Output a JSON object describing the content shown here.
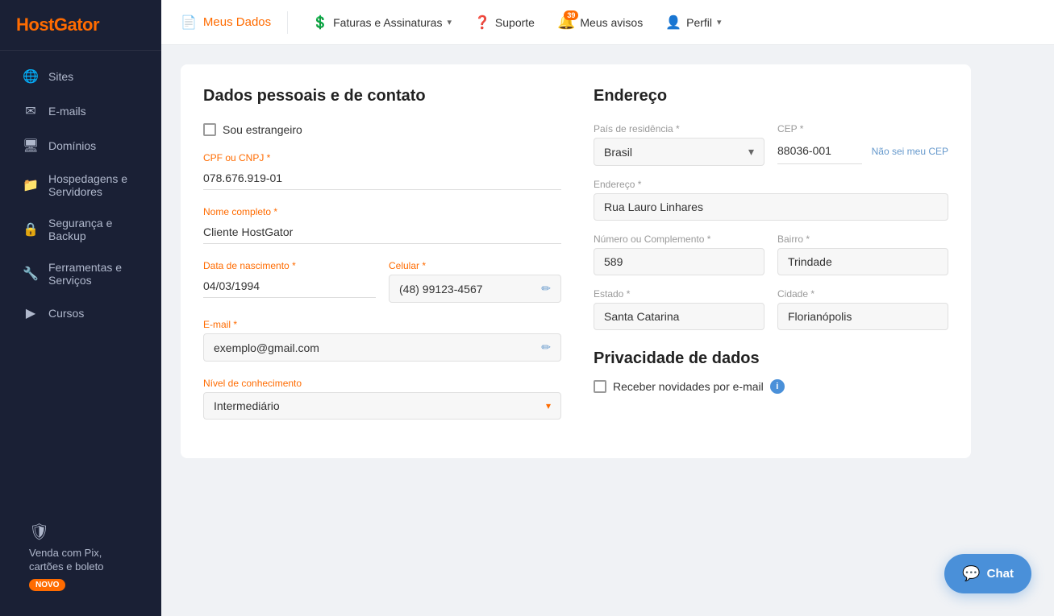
{
  "brand": {
    "name_part1": "Host",
    "name_part2": "Gator"
  },
  "sidebar": {
    "items": [
      {
        "id": "sites",
        "label": "Sites",
        "icon": "🌐"
      },
      {
        "id": "emails",
        "label": "E-mails",
        "icon": "✉"
      },
      {
        "id": "dominios",
        "label": "Domínios",
        "icon": "🖥"
      },
      {
        "id": "hospedagens",
        "label": "Hospedagens e Servidores",
        "icon": "📁"
      },
      {
        "id": "seguranca",
        "label": "Segurança e Backup",
        "icon": "🔒"
      },
      {
        "id": "ferramentas",
        "label": "Ferramentas e Serviços",
        "icon": "🔧"
      },
      {
        "id": "cursos",
        "label": "Cursos",
        "icon": "▶"
      }
    ],
    "pix": {
      "label": "Venda com Pix, cartões e boleto",
      "badge": "NOVO"
    }
  },
  "header": {
    "page_icon": "📄",
    "page_title": "Meus Dados",
    "nav_items": [
      {
        "id": "faturas",
        "label": "Faturas e Assinaturas",
        "has_dropdown": true
      },
      {
        "id": "suporte",
        "label": "Suporte",
        "has_dropdown": false
      },
      {
        "id": "avisos",
        "label": "Meus avisos",
        "badge": "39",
        "has_bell": true
      },
      {
        "id": "perfil",
        "label": "Perfil",
        "has_dropdown": true
      }
    ]
  },
  "personal_section": {
    "title": "Dados pessoais e de contato",
    "foreign_label": "Sou estrangeiro",
    "fields": {
      "cpf_label": "CPF ou CNPJ *",
      "cpf_value": "078.676.919-01",
      "nome_label": "Nome completo *",
      "nome_value": "Cliente HostGator",
      "nascimento_label": "Data de nascimento *",
      "nascimento_value": "04/03/1994",
      "celular_label": "Celular *",
      "celular_value": "(48) 99123-4567",
      "email_label": "E-mail *",
      "email_value": "exemplo@gmail.com",
      "nivel_label": "Nível de conhecimento",
      "nivel_value": "Intermediário"
    }
  },
  "address_section": {
    "title": "Endereço",
    "fields": {
      "pais_label": "País de residência *",
      "pais_value": "Brasil",
      "cep_label": "CEP *",
      "cep_value": "88036-001",
      "cep_link": "Não sei meu CEP",
      "endereco_label": "Endereço *",
      "endereco_value": "Rua Lauro Linhares",
      "numero_label": "Número ou Complemento *",
      "numero_value": "589",
      "bairro_label": "Bairro *",
      "bairro_value": "Trindade",
      "estado_label": "Estado *",
      "estado_value": "Santa Catarina",
      "cidade_label": "Cidade *",
      "cidade_value": "Florianópolis"
    }
  },
  "privacy_section": {
    "title": "Privacidade de dados",
    "newsletter_label": "Receber novidades por e-mail"
  },
  "chat": {
    "label": "Chat"
  }
}
